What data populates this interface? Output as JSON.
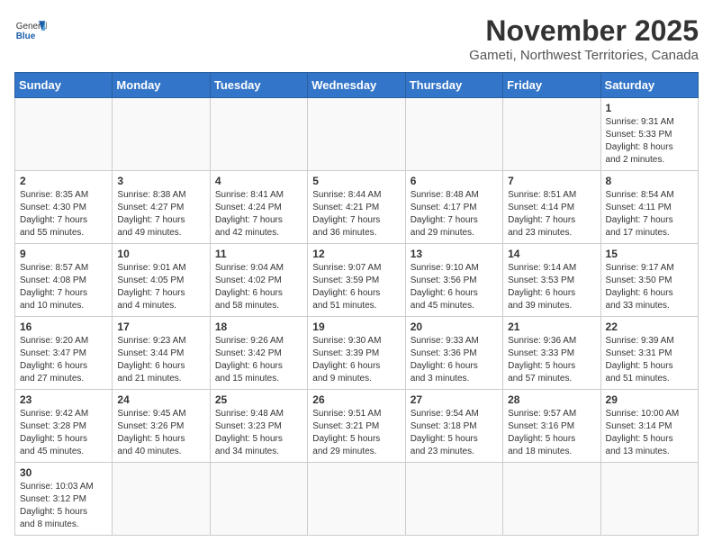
{
  "header": {
    "logo_general": "General",
    "logo_blue": "Blue",
    "month_year": "November 2025",
    "location": "Gameti, Northwest Territories, Canada"
  },
  "weekdays": [
    "Sunday",
    "Monday",
    "Tuesday",
    "Wednesday",
    "Thursday",
    "Friday",
    "Saturday"
  ],
  "weeks": [
    [
      {
        "day": "",
        "info": ""
      },
      {
        "day": "",
        "info": ""
      },
      {
        "day": "",
        "info": ""
      },
      {
        "day": "",
        "info": ""
      },
      {
        "day": "",
        "info": ""
      },
      {
        "day": "",
        "info": ""
      },
      {
        "day": "1",
        "info": "Sunrise: 9:31 AM\nSunset: 5:33 PM\nDaylight: 8 hours\nand 2 minutes."
      }
    ],
    [
      {
        "day": "2",
        "info": "Sunrise: 8:35 AM\nSunset: 4:30 PM\nDaylight: 7 hours\nand 55 minutes."
      },
      {
        "day": "3",
        "info": "Sunrise: 8:38 AM\nSunset: 4:27 PM\nDaylight: 7 hours\nand 49 minutes."
      },
      {
        "day": "4",
        "info": "Sunrise: 8:41 AM\nSunset: 4:24 PM\nDaylight: 7 hours\nand 42 minutes."
      },
      {
        "day": "5",
        "info": "Sunrise: 8:44 AM\nSunset: 4:21 PM\nDaylight: 7 hours\nand 36 minutes."
      },
      {
        "day": "6",
        "info": "Sunrise: 8:48 AM\nSunset: 4:17 PM\nDaylight: 7 hours\nand 29 minutes."
      },
      {
        "day": "7",
        "info": "Sunrise: 8:51 AM\nSunset: 4:14 PM\nDaylight: 7 hours\nand 23 minutes."
      },
      {
        "day": "8",
        "info": "Sunrise: 8:54 AM\nSunset: 4:11 PM\nDaylight: 7 hours\nand 17 minutes."
      }
    ],
    [
      {
        "day": "9",
        "info": "Sunrise: 8:57 AM\nSunset: 4:08 PM\nDaylight: 7 hours\nand 10 minutes."
      },
      {
        "day": "10",
        "info": "Sunrise: 9:01 AM\nSunset: 4:05 PM\nDaylight: 7 hours\nand 4 minutes."
      },
      {
        "day": "11",
        "info": "Sunrise: 9:04 AM\nSunset: 4:02 PM\nDaylight: 6 hours\nand 58 minutes."
      },
      {
        "day": "12",
        "info": "Sunrise: 9:07 AM\nSunset: 3:59 PM\nDaylight: 6 hours\nand 51 minutes."
      },
      {
        "day": "13",
        "info": "Sunrise: 9:10 AM\nSunset: 3:56 PM\nDaylight: 6 hours\nand 45 minutes."
      },
      {
        "day": "14",
        "info": "Sunrise: 9:14 AM\nSunset: 3:53 PM\nDaylight: 6 hours\nand 39 minutes."
      },
      {
        "day": "15",
        "info": "Sunrise: 9:17 AM\nSunset: 3:50 PM\nDaylight: 6 hours\nand 33 minutes."
      }
    ],
    [
      {
        "day": "16",
        "info": "Sunrise: 9:20 AM\nSunset: 3:47 PM\nDaylight: 6 hours\nand 27 minutes."
      },
      {
        "day": "17",
        "info": "Sunrise: 9:23 AM\nSunset: 3:44 PM\nDaylight: 6 hours\nand 21 minutes."
      },
      {
        "day": "18",
        "info": "Sunrise: 9:26 AM\nSunset: 3:42 PM\nDaylight: 6 hours\nand 15 minutes."
      },
      {
        "day": "19",
        "info": "Sunrise: 9:30 AM\nSunset: 3:39 PM\nDaylight: 6 hours\nand 9 minutes."
      },
      {
        "day": "20",
        "info": "Sunrise: 9:33 AM\nSunset: 3:36 PM\nDaylight: 6 hours\nand 3 minutes."
      },
      {
        "day": "21",
        "info": "Sunrise: 9:36 AM\nSunset: 3:33 PM\nDaylight: 5 hours\nand 57 minutes."
      },
      {
        "day": "22",
        "info": "Sunrise: 9:39 AM\nSunset: 3:31 PM\nDaylight: 5 hours\nand 51 minutes."
      }
    ],
    [
      {
        "day": "23",
        "info": "Sunrise: 9:42 AM\nSunset: 3:28 PM\nDaylight: 5 hours\nand 45 minutes."
      },
      {
        "day": "24",
        "info": "Sunrise: 9:45 AM\nSunset: 3:26 PM\nDaylight: 5 hours\nand 40 minutes."
      },
      {
        "day": "25",
        "info": "Sunrise: 9:48 AM\nSunset: 3:23 PM\nDaylight: 5 hours\nand 34 minutes."
      },
      {
        "day": "26",
        "info": "Sunrise: 9:51 AM\nSunset: 3:21 PM\nDaylight: 5 hours\nand 29 minutes."
      },
      {
        "day": "27",
        "info": "Sunrise: 9:54 AM\nSunset: 3:18 PM\nDaylight: 5 hours\nand 23 minutes."
      },
      {
        "day": "28",
        "info": "Sunrise: 9:57 AM\nSunset: 3:16 PM\nDaylight: 5 hours\nand 18 minutes."
      },
      {
        "day": "29",
        "info": "Sunrise: 10:00 AM\nSunset: 3:14 PM\nDaylight: 5 hours\nand 13 minutes."
      }
    ],
    [
      {
        "day": "30",
        "info": "Sunrise: 10:03 AM\nSunset: 3:12 PM\nDaylight: 5 hours\nand 8 minutes."
      },
      {
        "day": "",
        "info": ""
      },
      {
        "day": "",
        "info": ""
      },
      {
        "day": "",
        "info": ""
      },
      {
        "day": "",
        "info": ""
      },
      {
        "day": "",
        "info": ""
      },
      {
        "day": "",
        "info": ""
      }
    ]
  ]
}
